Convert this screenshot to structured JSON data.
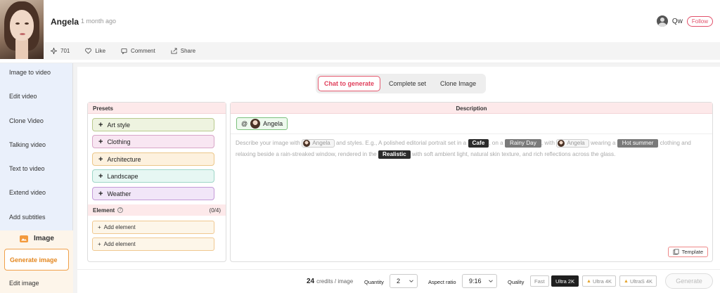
{
  "header": {
    "user_name": "Angela",
    "time_ago": "1 month ago",
    "owner_name": "Qw",
    "follow_label": "Follow",
    "actions": {
      "likes_count": "701",
      "like_label": "Like",
      "comment_label": "Comment",
      "share_label": "Share"
    }
  },
  "sidebar": {
    "items": [
      "Image to video",
      "Edit video",
      "Clone Video",
      "Talking video",
      "Text to video",
      "Extend video",
      "Add subtitles"
    ],
    "section_title": "Image",
    "active_item": "Generate image",
    "after_item": "Edit image"
  },
  "tabs": [
    "Chat to generate",
    "Complete set",
    "Clone Image"
  ],
  "presets": {
    "title": "Presets",
    "items": [
      {
        "label": "Art style",
        "color": "#eef3e0",
        "border": "#b9c98d"
      },
      {
        "label": "Clothing",
        "color": "#f8e6f2",
        "border": "#d8a6c8"
      },
      {
        "label": "Architecture",
        "color": "#fdf1de",
        "border": "#ecc78a"
      },
      {
        "label": "Landscape",
        "color": "#e6f7f3",
        "border": "#9fd6c8"
      },
      {
        "label": "Weather",
        "color": "#f1e6f8",
        "border": "#c49ad8"
      }
    ],
    "element_label": "Element",
    "element_count": "(0/4)",
    "add_element_label": "Add element"
  },
  "description": {
    "title": "Description",
    "mention_at": "@",
    "mention_name": "Angela",
    "text_1": "Describe your image with",
    "ref_name": "Angela",
    "text_2": "and styles. E.g., A polished editorial portrait set in a",
    "chip_cafe": "Cafe",
    "text_3": ", on a",
    "chip_rainy": "Rainy Day",
    "text_4": ", with",
    "text_5": "wearing a",
    "chip_hot": "Hot summer",
    "text_6": "clothing and relaxing beside a rain-streaked window, rendered in the",
    "chip_realistic": "Realistic",
    "text_7": "with soft ambient light, natural skin texture, and rich reflections across the glass.",
    "template_label": "Template"
  },
  "bottom": {
    "credits_value": "24",
    "credits_unit": "credits / image",
    "quantity_label": "Quantity",
    "quantity_value": "2",
    "aspect_label": "Aspect ratio",
    "aspect_value": "9:16",
    "quality_label": "Quality",
    "quality_options": [
      "Fast",
      "Ultra 2K",
      "Ultra 4K",
      "UltraS 4K"
    ],
    "generate_label": "Generate"
  }
}
